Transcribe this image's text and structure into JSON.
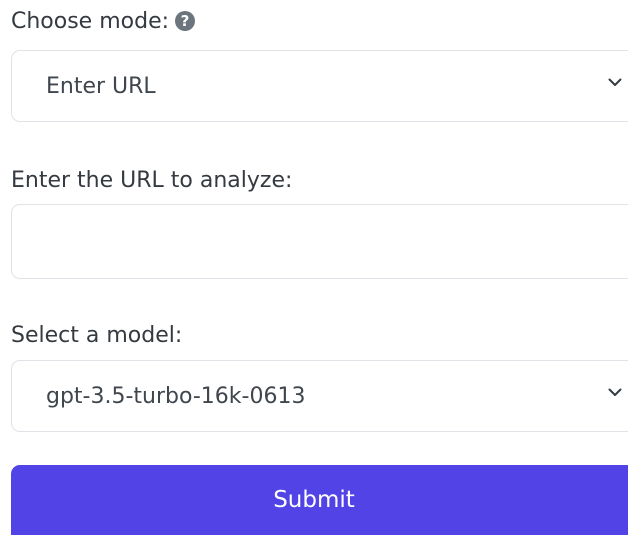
{
  "mode": {
    "label": "Choose mode:",
    "help_icon": "question-circle-icon",
    "help_glyph": "?",
    "selected": "Enter URL"
  },
  "url": {
    "label": "Enter the URL to analyze:",
    "value": ""
  },
  "model": {
    "label": "Select a model:",
    "selected": "gpt-3.5-turbo-16k-0613"
  },
  "submit": {
    "label": "Submit"
  },
  "colors": {
    "primary": "#5243e6",
    "border": "#dfe2e6",
    "text": "#343a40"
  }
}
